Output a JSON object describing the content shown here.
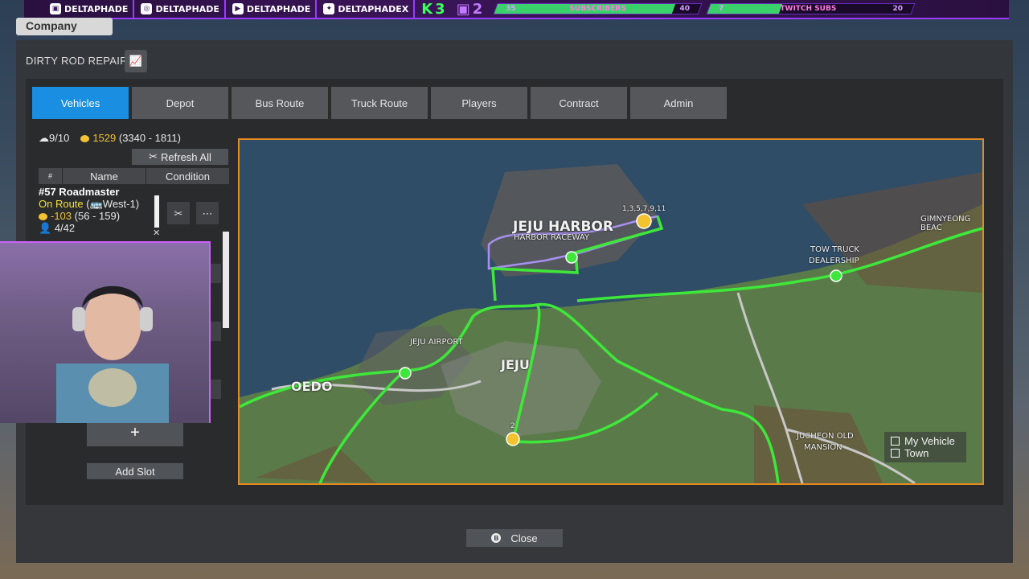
{
  "stream_overlay": {
    "socials": [
      {
        "icon": "twitch-icon",
        "handle": "DELTAPHADE"
      },
      {
        "icon": "instagram-icon",
        "handle": "DELTAPHADE"
      },
      {
        "icon": "youtube-icon",
        "handle": "DELTAPHADE"
      },
      {
        "icon": "twitter-icon",
        "handle": "DELTAPHADEX"
      }
    ],
    "kick_count": "3",
    "twitch_count": "2",
    "subscribers_goal": {
      "current": "35",
      "label": "SUBSCRIBERS",
      "target": "40",
      "progress": 0.875
    },
    "twitch_subs_goal": {
      "current": "7",
      "label": "TWITCH SUBS",
      "target": "20",
      "progress": 0.35
    }
  },
  "company_tab": "Company",
  "window": {
    "title": "DIRTY ROD REPAIR",
    "tabs": [
      "Vehicles",
      "Depot",
      "Bus Route",
      "Truck Route",
      "Players",
      "Contract",
      "Admin"
    ],
    "active_tab": "Vehicles",
    "stats": {
      "vehicles": "9/10",
      "money": "1529",
      "money_range": "(3340 - 1811)"
    },
    "refresh_label": "Refresh All",
    "table_headers": {
      "num": "#",
      "name": "Name",
      "condition": "Condition"
    },
    "vehicle": {
      "name": "#57 Roadmaster",
      "status": "On Route",
      "route": "(🚌West-1)",
      "money": "-103",
      "money_range": "(56 - 159)",
      "passengers": "4/42",
      "condition": 0.9
    },
    "plus_label": "+",
    "add_slot_label": "Add Slot",
    "close_label": "Close",
    "close_key": "B"
  },
  "map": {
    "labels": {
      "jeju_harbor": "JEJU HARBOR",
      "harbor_raceway": "HARBOR RACEWAY",
      "gimnyeong_beach": "GIMNYEONG BEAC",
      "tow_truck": "TOW TRUCK",
      "dealership": "DEALERSHIP",
      "jeju_airport": "JEJU AIRPORT",
      "jeju": "JEJU",
      "oedo": "OEDO",
      "jucheon_old": "JUCHEON OLD",
      "mansion": "MANSION",
      "stop_ids": "1,3,5,7,9,11",
      "stop_2": "2"
    },
    "legend": [
      {
        "label": "My Vehicle"
      },
      {
        "label": "Town"
      }
    ],
    "colors": {
      "route": "#3ee83a",
      "purple_route": "#a890f0",
      "border": "#e48a20",
      "land": "#5b7a4a",
      "sea": "#2f4d66"
    }
  }
}
